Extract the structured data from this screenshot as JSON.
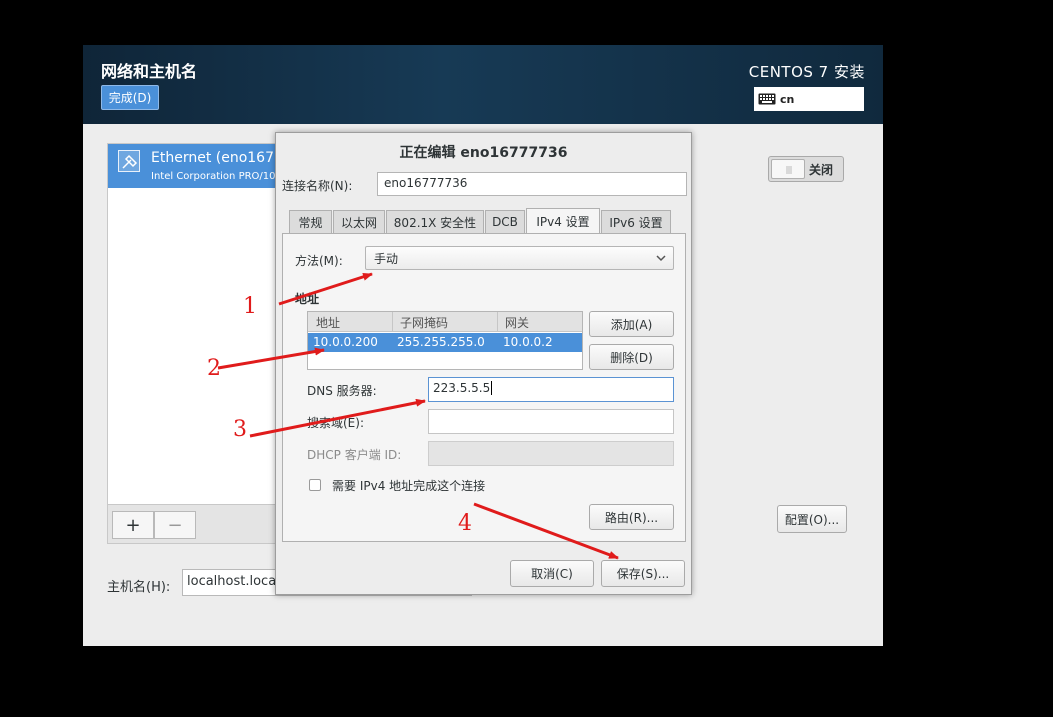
{
  "header": {
    "title": "网络和主机名",
    "done_label": "完成(D)",
    "product_title": "CENTOS 7 安装",
    "keyboard_layout": "cn"
  },
  "device": {
    "name": "Ethernet (eno167",
    "subtitle": "Intel Corporation PRO/10"
  },
  "list_bar": {
    "add": "+",
    "remove": "−"
  },
  "hostname": {
    "label": "主机名(H):",
    "value": "localhost.local"
  },
  "toggle": {
    "label": "关闭"
  },
  "configure_label": "配置(O)...",
  "dialog": {
    "title": "正在编辑 eno16777736",
    "connection_name_label": "连接名称(N):",
    "connection_name_value": "eno16777736",
    "tabs": [
      {
        "label": "常规"
      },
      {
        "label": "以太网"
      },
      {
        "label": "802.1X 安全性"
      },
      {
        "label": "DCB"
      },
      {
        "label": "IPv4 设置"
      },
      {
        "label": "IPv6 设置"
      }
    ],
    "active_tab": "IPv4 设置",
    "method_label": "方法(M):",
    "method_value": "手动",
    "address_section": "地址",
    "table": {
      "headers": [
        "地址",
        "子网掩码",
        "网关"
      ],
      "rows": [
        {
          "address": "10.0.0.200",
          "netmask": "255.255.255.0",
          "gateway": "10.0.0.2"
        }
      ]
    },
    "add_label": "添加(A)",
    "delete_label": "删除(D)",
    "dns_label": "DNS 服务器:",
    "dns_value": "223.5.5.5",
    "search_label": "搜索域(E):",
    "search_value": "",
    "dhcp_label": "DHCP 客户端 ID:",
    "dhcp_value": "",
    "require_ipv4_label": "需要 IPv4 地址完成这个连接",
    "require_ipv4_checked": false,
    "routes_label": "路由(R)...",
    "cancel_label": "取消(C)",
    "save_label": "保存(S)..."
  },
  "annotations": {
    "color": "#e01b1b",
    "numbers": [
      "1",
      "2",
      "3",
      "4"
    ]
  }
}
